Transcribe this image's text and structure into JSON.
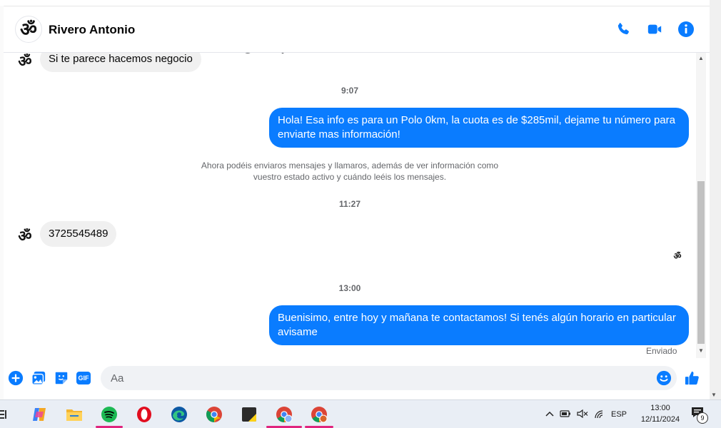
{
  "header": {
    "contact_name": "Rivero Antonio",
    "avatar_glyph": "ॐ",
    "icons": [
      "phone-icon",
      "video-camera-icon",
      "info-icon"
    ],
    "accent_color": "#0a7cff"
  },
  "messages": {
    "msg1": {
      "text": "Si te parece hacemos negocio",
      "direction": "incoming"
    },
    "ts1": "9:07",
    "msg2": {
      "text": "Hola! Esa info es para un Polo 0km, la cuota es de $285mil, dejame tu número para enviarte mas información!",
      "direction": "outgoing"
    },
    "notice_line1": "Ahora podéis enviaros mensajes y llamaros, además de ver información como",
    "notice_line2": "vuestro estado activo y cuándo leéis los mensajes.",
    "ts2": "11:27",
    "msg3": {
      "text": "3725545489",
      "direction": "incoming"
    },
    "ts3": "13:00",
    "msg4": {
      "text": "Buenisimo, entre hoy y mañana te contactamos! Si tenés algún horario en particular avisame",
      "direction": "outgoing"
    },
    "status": "Enviado"
  },
  "composer": {
    "placeholder": "Aa",
    "gif_label": "GIF"
  },
  "taskbar": {
    "language": "ESP",
    "time": "13:00",
    "date": "12/11/2024",
    "notification_count": "9"
  }
}
